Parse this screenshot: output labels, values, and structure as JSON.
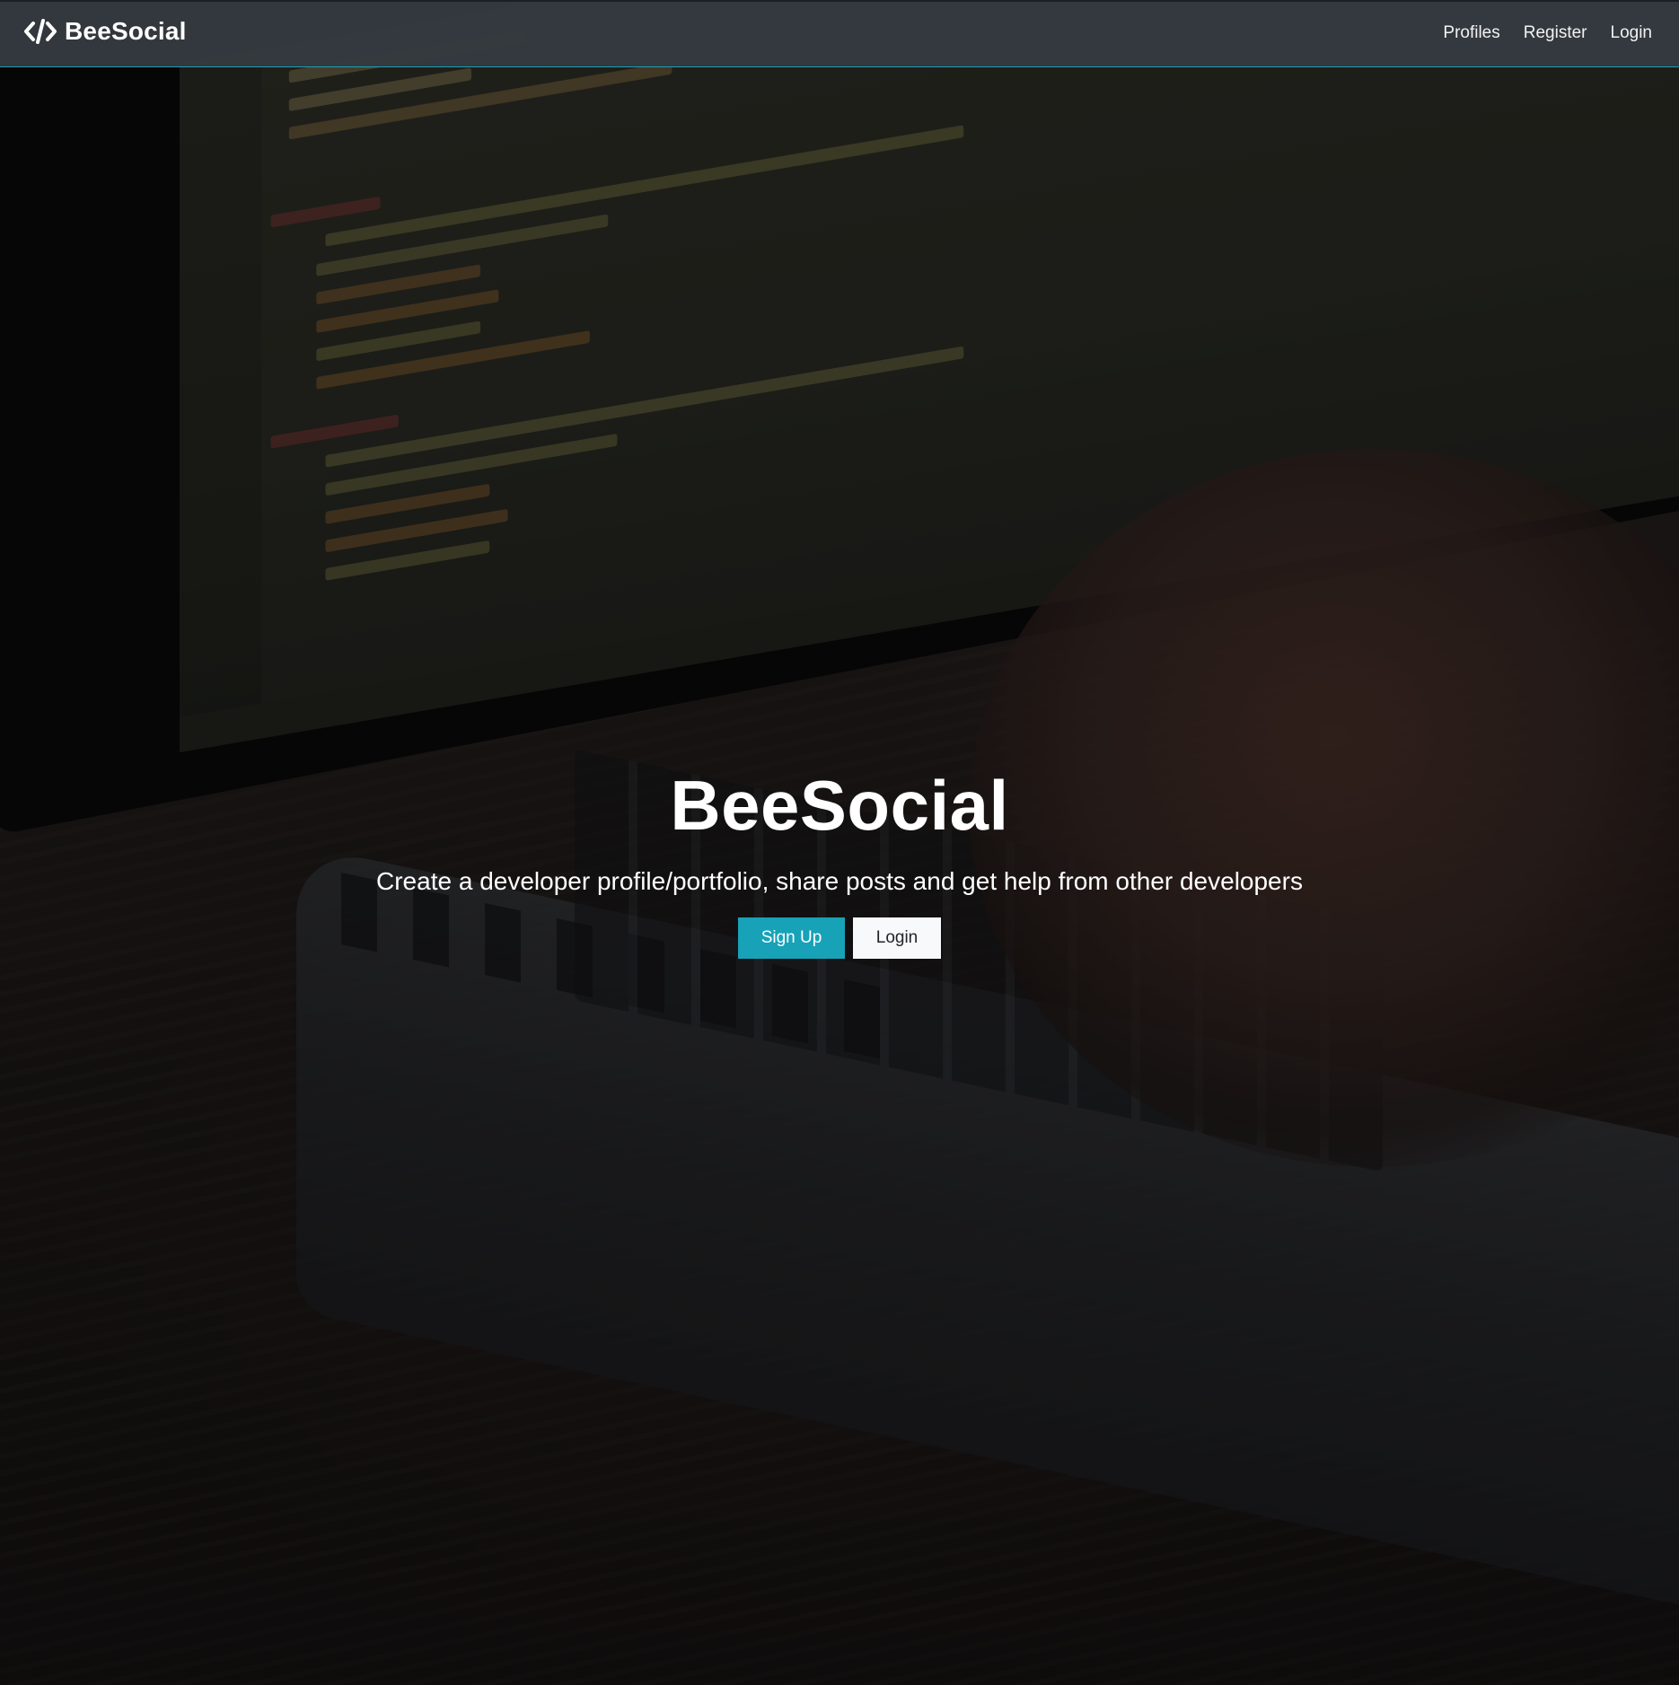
{
  "navbar": {
    "brand": "BeeSocial",
    "brand_icon": "code-icon",
    "links": [
      "Profiles",
      "Register",
      "Login"
    ]
  },
  "hero": {
    "title": "BeeSocial",
    "lead": "Create a developer profile/portfolio, share posts and get help from other developers",
    "signup_label": "Sign Up",
    "login_label": "Login"
  },
  "colors": {
    "navbar_bg": "#343a40",
    "accent": "#17a2b8",
    "light_button": "#f8f9fa"
  }
}
